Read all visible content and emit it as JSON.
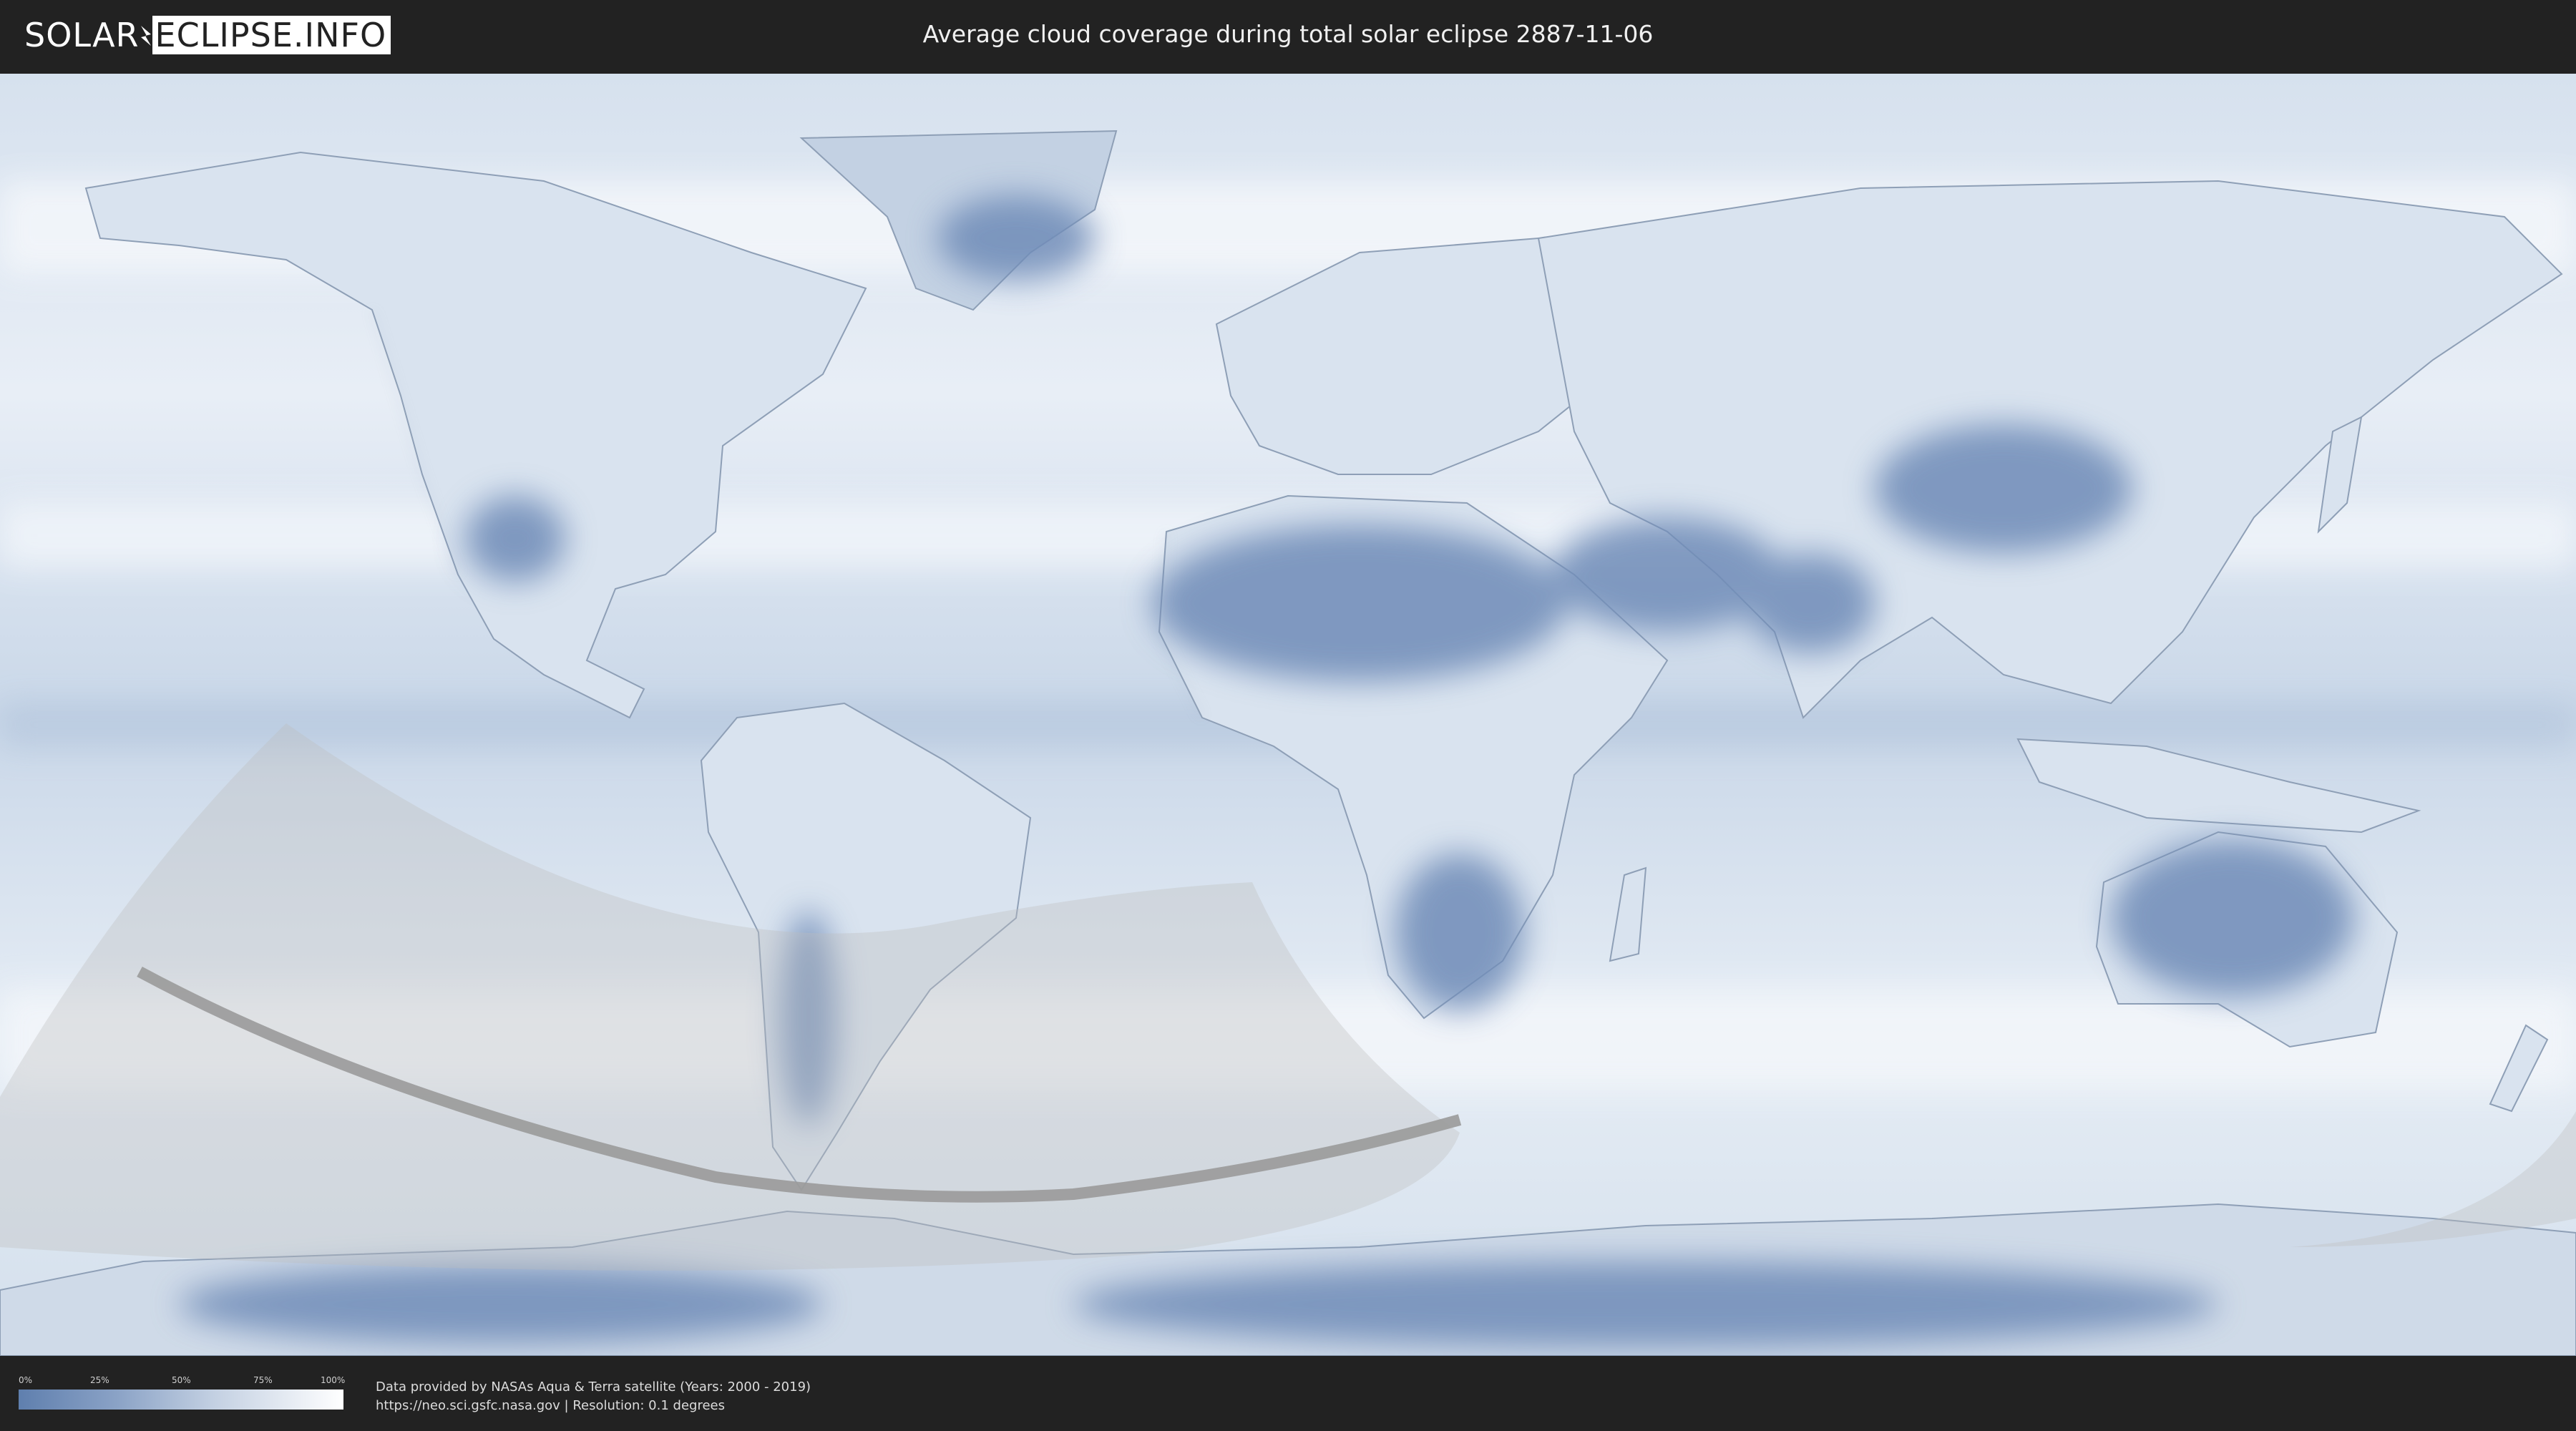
{
  "header": {
    "logo_left": "SOLAR",
    "logo_right": "ECLIPSE.INFO",
    "title": "Average cloud coverage during total solar eclipse 2887-11-06"
  },
  "map": {
    "type": "cloud-coverage-world-map",
    "projection": "equirectangular",
    "features": [
      {
        "name": "penumbra-region",
        "color": "#c8c8c8"
      },
      {
        "name": "totality-path",
        "color": "#9a9a9a"
      }
    ],
    "colors": {
      "ocean_cloudy": "#dde6f0",
      "clear_sky": "#5b7baa",
      "full_cloud": "#ffffff"
    }
  },
  "legend": {
    "ticks": [
      "0%",
      "25%",
      "50%",
      "75%",
      "100%"
    ],
    "gradient_start": "#5f7fae",
    "gradient_end": "#ffffff"
  },
  "footer": {
    "credit_line_1": "Data provided by NASAs Aqua & Terra satellite (Years: 2000 - 2019)",
    "credit_line_2": "https://neo.sci.gsfc.nasa.gov | Resolution: 0.1 degrees"
  }
}
